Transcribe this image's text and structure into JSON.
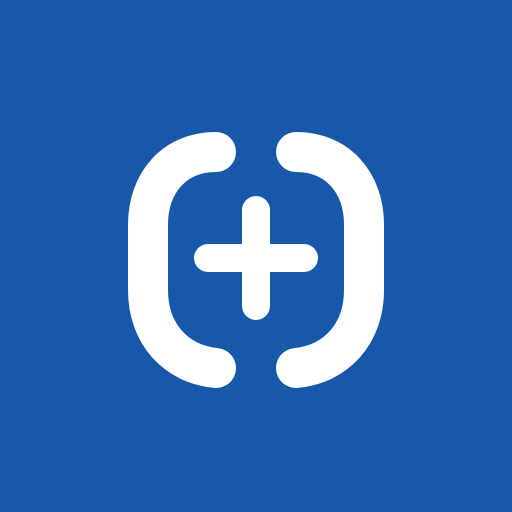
{
  "icon": {
    "name": "add-in-brackets-icon",
    "background_color": "#1759A8",
    "glyph_color": "#FFFFFF"
  }
}
